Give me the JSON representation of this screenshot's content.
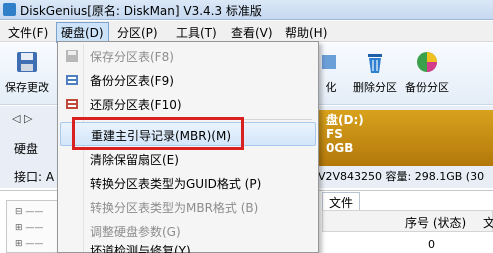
{
  "window": {
    "title": "DiskGenius[原名: DiskMan] V3.4.3 标准版"
  },
  "menubar": {
    "items": [
      {
        "label": "文件(F)"
      },
      {
        "label": "硬盘(D)"
      },
      {
        "label": "分区(P)"
      },
      {
        "label": "工具(T)"
      },
      {
        "label": "查看(V)"
      },
      {
        "label": "帮助(H)"
      }
    ]
  },
  "toolbar": {
    "save_label": "保存更改",
    "partial_label": "化",
    "delete_label": "删除分区",
    "backup_label": "备份分区"
  },
  "diskbar": {
    "nav": "◁ ▷",
    "disk_label": "硬盘",
    "iface_label": "接口: A",
    "partition_lines": [
      "盘(D:)",
      "FS",
      "0GB"
    ],
    "info": "V2V843250  容量: 298.1GB (30"
  },
  "content": {
    "tab_file": "文件",
    "col_seq": "序号 (状态)",
    "col_extra": "文",
    "cell_value": "0"
  },
  "dropdown": {
    "items": [
      {
        "label": "保存分区表(F8)",
        "disabled": true
      },
      {
        "label": "备份分区表(F9)",
        "disabled": false
      },
      {
        "label": "还原分区表(F10)",
        "disabled": false
      },
      {
        "label": "重建主引导记录(MBR)(M)",
        "disabled": false
      },
      {
        "label": "清除保留扇区(E)",
        "disabled": false
      },
      {
        "label": "转换分区表类型为GUID格式 (P)",
        "disabled": false
      },
      {
        "label": "转换分区表类型为MBR格式 (B)",
        "disabled": true
      },
      {
        "label": "调整硬盘参数(G)",
        "disabled": true
      },
      {
        "label": "坏道检测与修复(Y)",
        "disabled": false
      }
    ]
  },
  "colors": {
    "highlight_border": "#d9221f",
    "menu_active": "#cde3f9",
    "partition": "#c58b12"
  }
}
